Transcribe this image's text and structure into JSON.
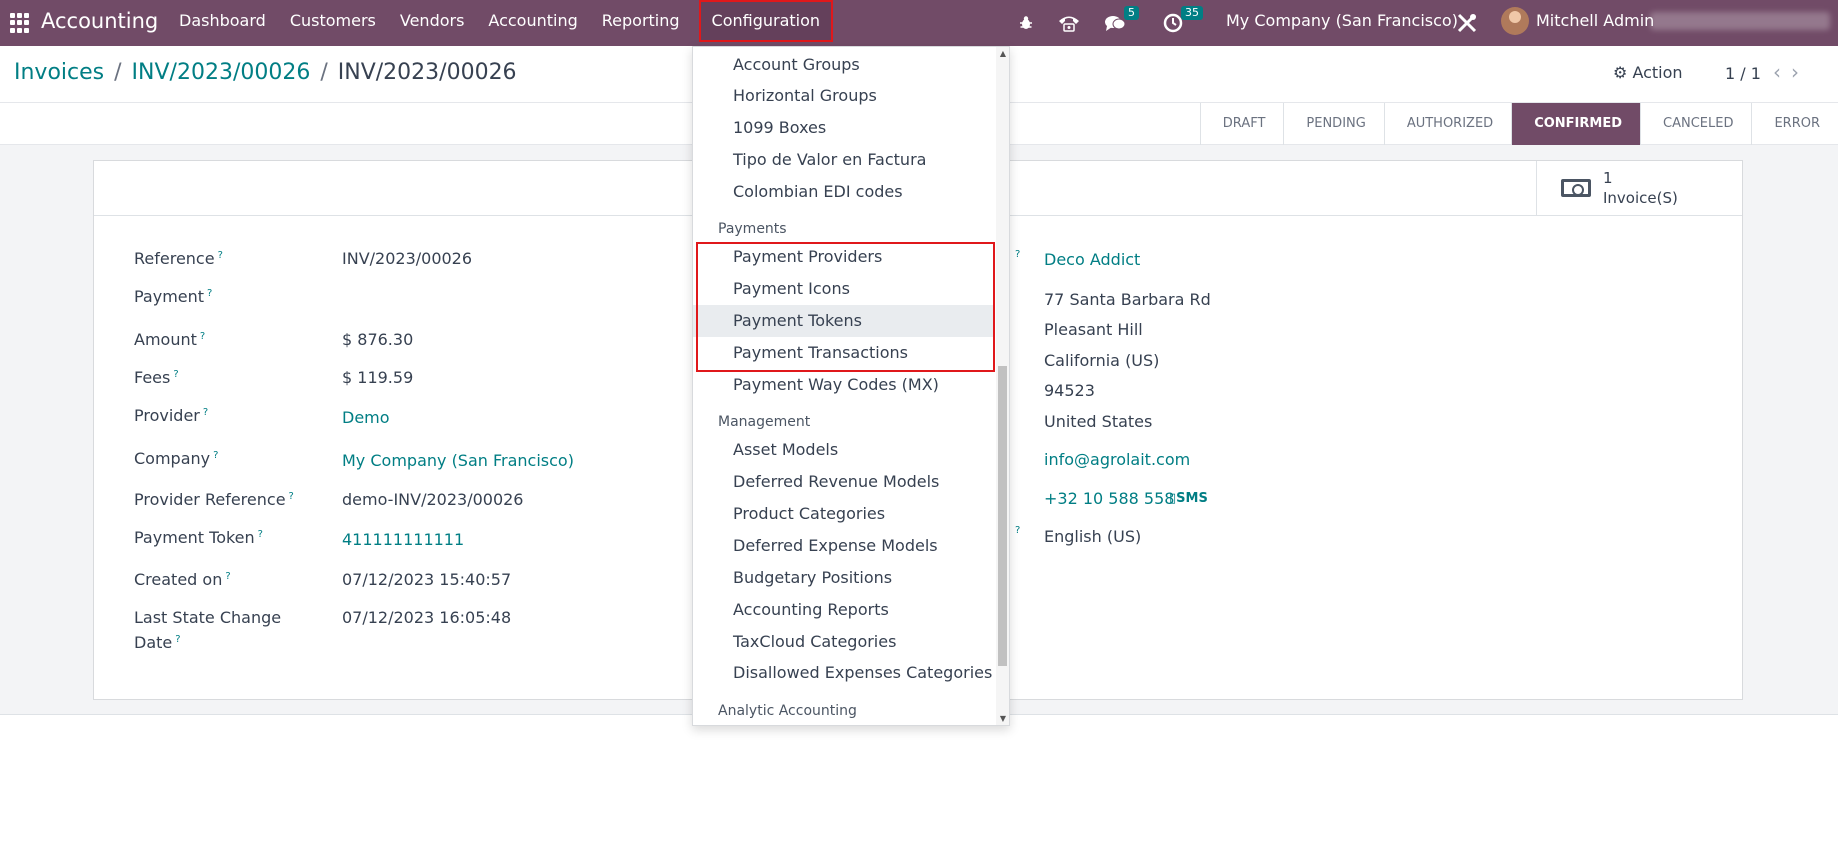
{
  "navbar": {
    "app_name": "Accounting",
    "menu": [
      "Dashboard",
      "Customers",
      "Vendors",
      "Accounting",
      "Reporting",
      "Configuration"
    ],
    "active_menu": "Configuration",
    "chat_badge": "5",
    "activity_badge": "35",
    "company": "My Company (San Francisco)",
    "user": "Mitchell Admin",
    "icons": [
      "apps-grid-icon",
      "bug-icon",
      "phone-icon",
      "chat-icon",
      "clock-icon",
      "tools-icon",
      "avatar"
    ]
  },
  "control_panel": {
    "breadcrumb": [
      "Invoices",
      "INV/2023/00026",
      "INV/2023/00026"
    ],
    "action_label": "Action",
    "pager": "1 / 1"
  },
  "statusbar": {
    "states": [
      "DRAFT",
      "PENDING",
      "AUTHORIZED",
      "CONFIRMED",
      "CANCELED",
      "ERROR"
    ],
    "current_state": "CONFIRMED"
  },
  "smart_button": {
    "count": "1",
    "label": "Invoice(S)"
  },
  "form": {
    "left": [
      {
        "label": "Reference",
        "value": "INV/2023/00026"
      },
      {
        "label": "Payment",
        "value": ""
      },
      {
        "label": "Amount",
        "value": "$ 876.30"
      },
      {
        "label": "Fees",
        "value": "$ 119.59"
      },
      {
        "label": "Provider",
        "value": "Demo"
      },
      {
        "label": "Company",
        "value": "My Company (San Francisco)"
      },
      {
        "label": "Provider Reference",
        "value": "demo-INV/2023/00026"
      },
      {
        "label": "Payment Token",
        "value": "411111111111"
      },
      {
        "label": "Created on",
        "value": "07/12/2023 15:40:57"
      },
      {
        "label": "Last State Change",
        "label2": "Date",
        "value": "07/12/2023 16:05:48"
      }
    ],
    "right": {
      "partner": "Deco Addict",
      "street": "77 Santa Barbara Rd",
      "city": "Pleasant Hill",
      "state": "California (US)",
      "zip": "94523",
      "country": "United States",
      "email": "info@agrolait.com",
      "phone": "+32 10 588 558",
      "sms_label": "SMS",
      "language": "English (US)"
    }
  },
  "dropdown": {
    "items_top": [
      "Account Groups",
      "Horizontal Groups",
      "1099 Boxes",
      "Tipo de Valor en Factura",
      "Colombian EDI codes"
    ],
    "payments_header": "Payments",
    "payments_items": [
      "Payment Providers",
      "Payment Icons",
      "Payment Tokens",
      "Payment Transactions",
      "Payment Way Codes (MX)"
    ],
    "management_header": "Management",
    "management_items": [
      "Asset Models",
      "Deferred Revenue Models",
      "Product Categories",
      "Deferred Expense Models",
      "Budgetary Positions",
      "Accounting Reports",
      "TaxCloud Categories",
      "Disallowed Expenses Categories"
    ],
    "analytic_header": "Analytic Accounting",
    "hovered_item": "Payment Tokens"
  }
}
